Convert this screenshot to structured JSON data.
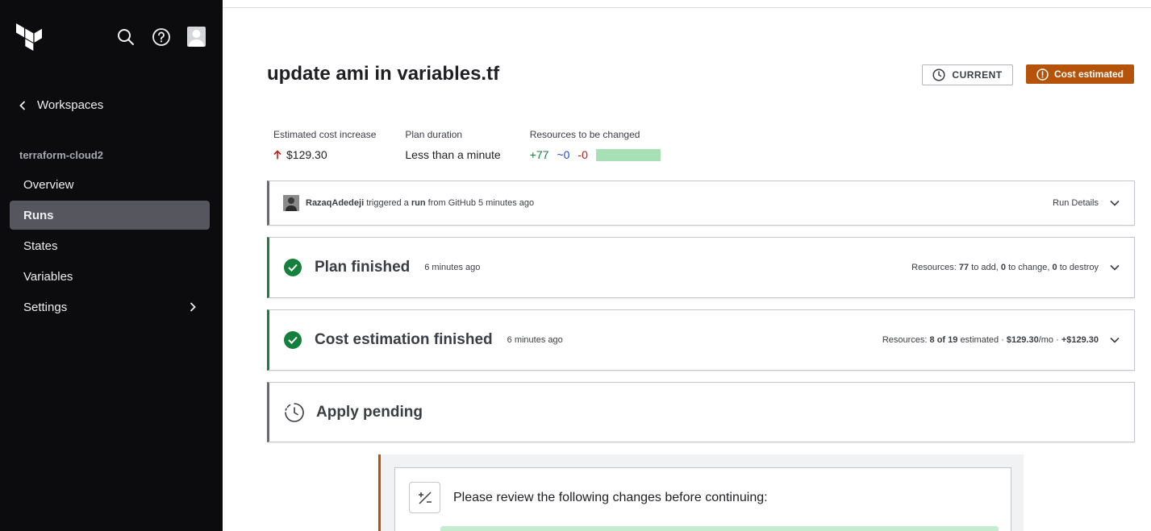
{
  "sidebar": {
    "back_label": "Workspaces",
    "org_name": "terraform-cloud2",
    "items": [
      {
        "label": "Overview"
      },
      {
        "label": "Runs"
      },
      {
        "label": "States"
      },
      {
        "label": "Variables"
      },
      {
        "label": "Settings"
      }
    ],
    "active_item": "Runs"
  },
  "run": {
    "title": "update ami in variables.tf",
    "badge_current": "CURRENT",
    "badge_status": "Cost estimated"
  },
  "stats": {
    "cost_label": "Estimated cost increase",
    "cost_value": "$129.30",
    "duration_label": "Plan duration",
    "duration_value": "Less than a minute",
    "resources_label": "Resources to be changed",
    "add": "+77",
    "change": "~0",
    "destroy": "-0"
  },
  "trigger": {
    "user": "RazaqAdedeji",
    "text1": "triggered a",
    "run_word": "run",
    "text2": "from GitHub 5 minutes ago",
    "details_label": "Run Details"
  },
  "plan": {
    "title": "Plan finished",
    "time": "6 minutes ago",
    "res_label": "Resources:",
    "add_n": "77",
    "add_t": "to add,",
    "change_n": "0",
    "change_t": "to change,",
    "destroy_n": "0",
    "destroy_t": "to destroy"
  },
  "cost": {
    "title": "Cost estimation finished",
    "time": "6 minutes ago",
    "res_label": "Resources:",
    "estimated_n": "8 of 19",
    "estimated_t": "estimated ·",
    "monthly": "$129.30",
    "per_mo": "/mo ·",
    "delta": "+$129.30"
  },
  "apply": {
    "title": "Apply pending"
  },
  "review": {
    "text": "Please review the following changes before continuing:"
  },
  "colors": {
    "sidebar_bg": "#0c0c0e",
    "success": "#15803d",
    "warning": "#b45309"
  }
}
